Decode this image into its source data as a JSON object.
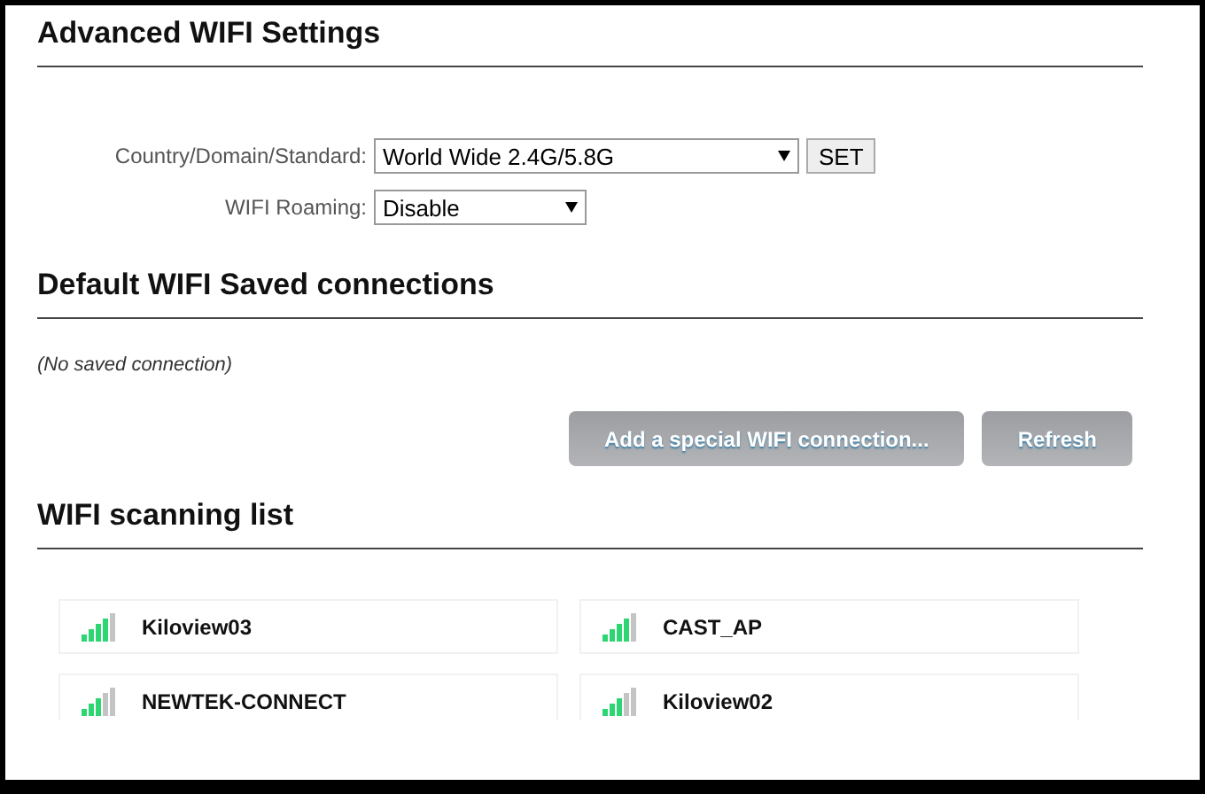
{
  "sections": [
    {
      "title": "Advanced WIFI Settings"
    },
    {
      "title": "Default WIFI Saved connections"
    },
    {
      "title": "WIFI scanning list"
    }
  ],
  "settings": [
    {
      "label": "Country/Domain/Standard:",
      "value": "World Wide 2.4G/5.8G",
      "button": "SET"
    },
    {
      "label": "WIFI Roaming:",
      "value": "Disable"
    }
  ],
  "saved_connections": {
    "empty_text": "(No saved connection)"
  },
  "buttons": [
    "Add a special WIFI connection...",
    "Refresh"
  ],
  "networks": [
    {
      "name": "Kiloview03",
      "level": 0.8
    },
    {
      "name": "CAST_AP",
      "level": 0.8
    },
    {
      "name": "NEWTEK-CONNECT",
      "level": 0.6
    },
    {
      "name": "Kiloview02",
      "level": 0.6
    }
  ]
}
